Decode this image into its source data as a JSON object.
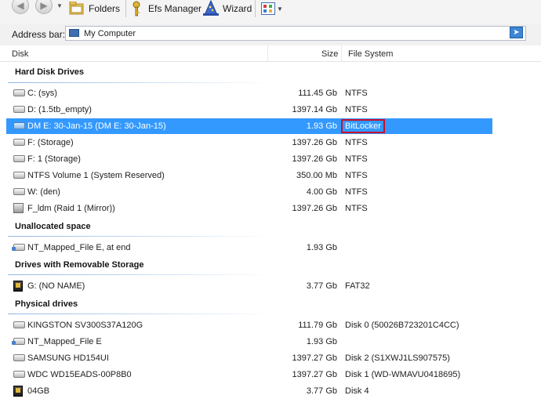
{
  "toolbar": {
    "folders_label": "Folders",
    "efs_label": "Efs Manager",
    "wizard_label": "Wizard"
  },
  "address": {
    "label": "Address bar:",
    "value": "My Computer"
  },
  "columns": {
    "disk": "Disk",
    "size": "Size",
    "fs": "File System"
  },
  "groups": [
    {
      "title": "Hard Disk Drives"
    },
    {
      "title": "Unallocated space"
    },
    {
      "title": "Drives with Removable Storage"
    },
    {
      "title": "Physical drives"
    }
  ],
  "rows": [
    {
      "name": "C: (sys)",
      "size": "111.45 Gb",
      "fs": "NTFS",
      "icon": "hdd-icon"
    },
    {
      "name": "D: (1.5tb_empty)",
      "size": "1397.14 Gb",
      "fs": "NTFS",
      "icon": "hdd-icon"
    },
    {
      "name": "DM E: 30-Jan-15 (DM E: 30-Jan-15)",
      "size": "1.93 Gb",
      "fs": "BitLocker",
      "icon": "hdd-icon",
      "selected": true
    },
    {
      "name": "F: (Storage)",
      "size": "1397.26 Gb",
      "fs": "NTFS",
      "icon": "hdd-icon"
    },
    {
      "name": "F: 1 (Storage)",
      "size": "1397.26 Gb",
      "fs": "NTFS",
      "icon": "hdd-icon"
    },
    {
      "name": "NTFS Volume 1 (System Reserved)",
      "size": "350.00 Mb",
      "fs": "NTFS",
      "icon": "hdd-icon"
    },
    {
      "name": "W: (den)",
      "size": "4.00 Gb",
      "fs": "NTFS",
      "icon": "hdd-icon"
    },
    {
      "name": "F_ldm (Raid 1 (Mirror))",
      "size": "1397.26 Gb",
      "fs": "NTFS",
      "icon": "raid-icon"
    },
    {
      "name": "NT_Mapped_File E, at end",
      "size": "1.93 Gb",
      "fs": "",
      "icon": "mapped-file-icon"
    },
    {
      "name": "G: (NO NAME)",
      "size": "3.77 Gb",
      "fs": "FAT32",
      "icon": "memory-card-icon"
    },
    {
      "name": "KINGSTON SV300S37A120G",
      "size": "111.79 Gb",
      "fs": "Disk 0 (50026B723201C4CC)",
      "icon": "hdd-icon"
    },
    {
      "name": "NT_Mapped_File E",
      "size": "1.93 Gb",
      "fs": "",
      "icon": "mapped-file-icon"
    },
    {
      "name": "SAMSUNG HD154UI",
      "size": "1397.27 Gb",
      "fs": "Disk 2 (S1XWJ1LS907575)",
      "icon": "hdd-icon"
    },
    {
      "name": "WDC WD15EADS-00P8B0",
      "size": "1397.27 Gb",
      "fs": "Disk 1 (WD-WMAVU0418695)",
      "icon": "hdd-icon"
    },
    {
      "name": "04GB",
      "size": "3.77 Gb",
      "fs": "Disk 4",
      "icon": "memory-card-icon"
    }
  ]
}
